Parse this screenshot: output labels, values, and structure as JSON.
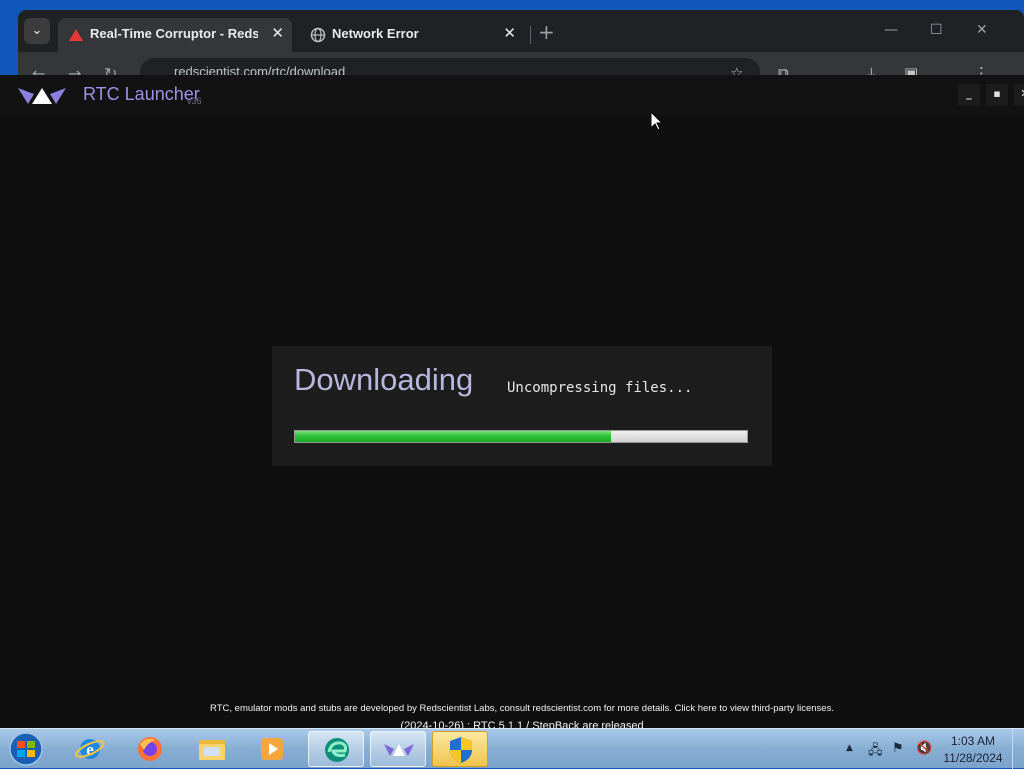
{
  "browser": {
    "tabs": [
      {
        "title": "Real-Time Corruptor - Redscie",
        "favicon": "redscientist-triangle-icon"
      },
      {
        "title": "Network Error",
        "favicon": "globe-icon"
      }
    ],
    "url": "redscientist.com/rtc/download"
  },
  "launcher": {
    "title": "RTC Launcher",
    "version": "v36",
    "download": {
      "heading": "Downloading",
      "status": "Uncompressing files...",
      "progress_fraction": 0.7
    },
    "footer_line1": "RTC, emulator mods and stubs are developed by Redscientist Labs, consult redscientist.com for more details. Click here to view third-party licenses.",
    "footer_line2": "(2024-10-26) : RTC 5.1.1 / StepBack are released"
  },
  "taskbar": {
    "items": [
      "start-orb",
      "internet-explorer",
      "firefox",
      "file-explorer",
      "media-player",
      "edge-app",
      "rtc-launcher",
      "uac-shield"
    ],
    "clock_time": "1:03 AM",
    "clock_date": "11/28/2024"
  },
  "colors": {
    "accent": "#9f92e6",
    "progress": "#2fc43a",
    "taskbar": "#87aed3"
  }
}
